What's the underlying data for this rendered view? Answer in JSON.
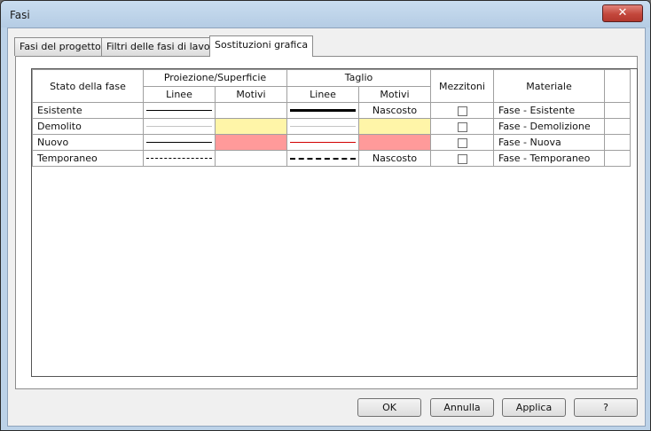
{
  "window": {
    "title": "Fasi",
    "close_glyph": "✕"
  },
  "tabs": [
    {
      "label": "Fasi del progetto",
      "active": false
    },
    {
      "label": "Filtri delle fasi di lavoro",
      "active": false
    },
    {
      "label": "Sostituzioni grafica",
      "active": true
    }
  ],
  "table": {
    "headers": {
      "stato": "Stato della fase",
      "proiezione": "Proiezione/Superficie",
      "taglio": "Taglio",
      "linee": "Linee",
      "motivi": "Motivi",
      "mezzitoni": "Mezzitoni",
      "materiale": "Materiale"
    },
    "rows": [
      {
        "stato": "Esistente",
        "proj_line": "solid-thin",
        "proj_pattern": "",
        "cut_line": "solid-thick",
        "cut_pattern": "Nascosto",
        "mezzitoni": false,
        "materiale": "Fase - Esistente"
      },
      {
        "stato": "Demolito",
        "proj_line": "solid-light",
        "proj_pattern_color": "#fff5a8",
        "cut_line": "solid-light",
        "cut_pattern_color": "#fff5a8",
        "cut_pattern": "",
        "mezzitoni": false,
        "materiale": "Fase - Demolizione"
      },
      {
        "stato": "Nuovo",
        "proj_line": "solid-thin",
        "proj_pattern_color": "#ff9a9a",
        "cut_line": "solid-red",
        "cut_pattern_color": "#ff9a9a",
        "cut_pattern": "",
        "mezzitoni": false,
        "materiale": "Fase - Nuova"
      },
      {
        "stato": "Temporaneo",
        "proj_line": "dashed",
        "proj_pattern": "",
        "cut_line": "dashed-thick",
        "cut_pattern": "Nascosto",
        "mezzitoni": false,
        "materiale": "Fase - Temporaneo"
      }
    ]
  },
  "buttons": {
    "ok": "OK",
    "cancel": "Annulla",
    "apply": "Applica",
    "help": "?"
  },
  "colors": {
    "demolito_fill": "#fff5a8",
    "nuovo_fill": "#ff9a9a",
    "nuovo_cut_line": "#d10000"
  }
}
